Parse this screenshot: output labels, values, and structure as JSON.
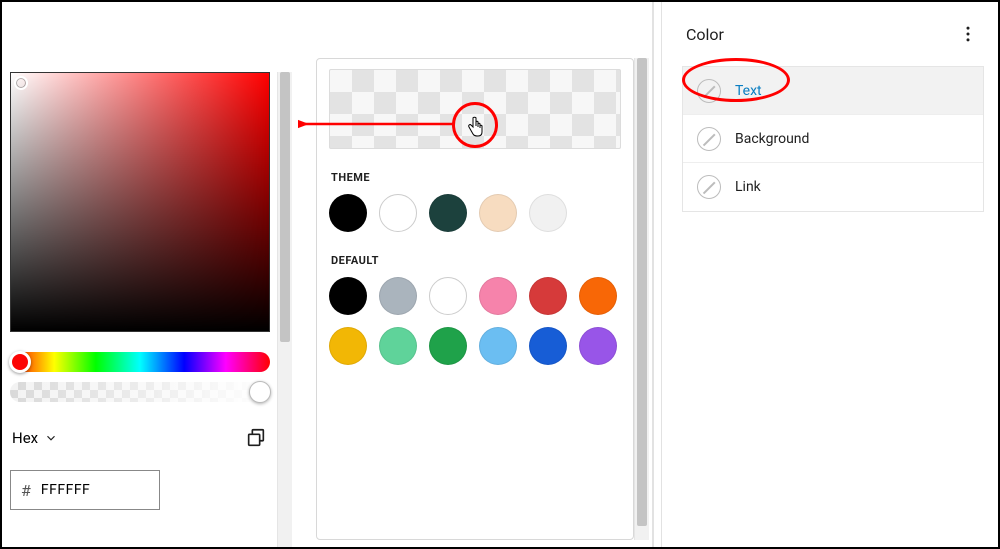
{
  "picker": {
    "format_label": "Hex",
    "hex_prefix": "#",
    "hex_value": "FFFFFF"
  },
  "palette": {
    "theme_label": "THEME",
    "default_label": "DEFAULT",
    "theme_colors": [
      "#000000",
      "#ffffff",
      "#1c413d",
      "#f7dcc0",
      "#f1f1f1"
    ],
    "default_row1": [
      "#000000",
      "#aab4bd",
      "#ffffff",
      "#f683ab",
      "#d63a3a",
      "#f86706"
    ],
    "default_row2": [
      "#f2b705",
      "#5fd39a",
      "#1fa24a",
      "#6bbef2",
      "#175dd6",
      "#9855e8"
    ]
  },
  "sidebar": {
    "title": "Color",
    "items": [
      {
        "label": "Text",
        "selected": true
      },
      {
        "label": "Background",
        "selected": false
      },
      {
        "label": "Link",
        "selected": false
      }
    ]
  }
}
